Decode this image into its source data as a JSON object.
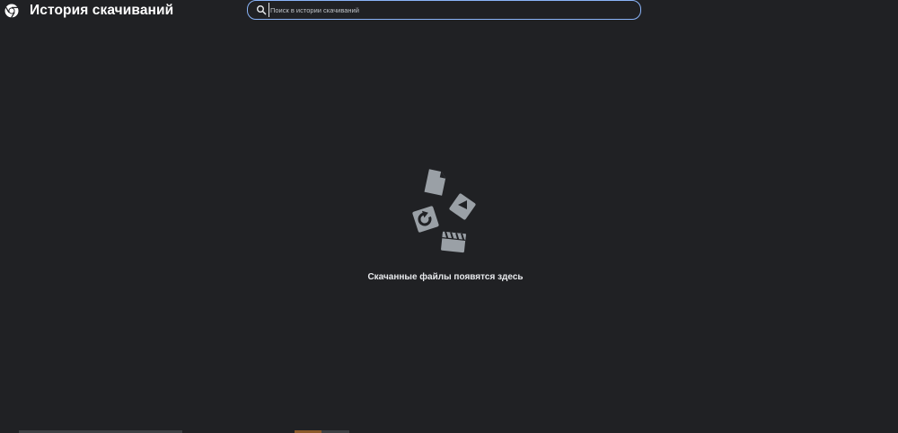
{
  "header": {
    "title": "История скачиваний",
    "logo_icon": "chrome-logo-icon"
  },
  "search": {
    "placeholder": "Поиск в истории скачиваний",
    "value": "",
    "icon": "search-icon"
  },
  "empty_state": {
    "message": "Скачанные файлы появятся здесь",
    "icons": [
      "document-icon",
      "video-icon",
      "audio-icon",
      "film-icon"
    ]
  },
  "colors": {
    "background": "#202124",
    "text": "#e8eaed",
    "search_border": "#8ab4f8",
    "icon_gray": "#9aa0a6"
  }
}
